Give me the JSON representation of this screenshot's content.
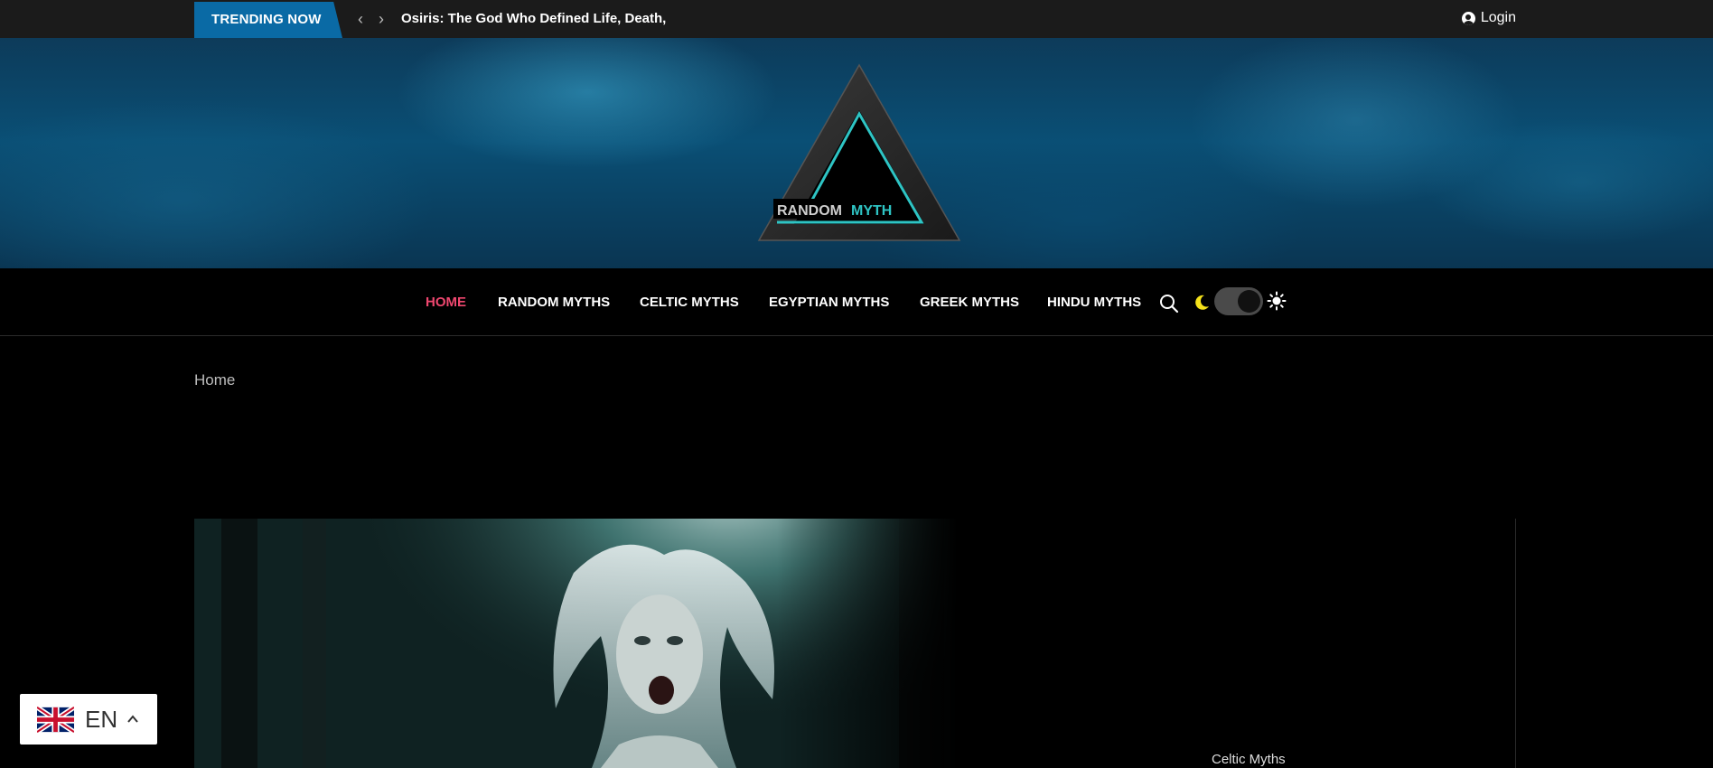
{
  "topbar": {
    "trending_label": "TRENDING NOW",
    "prev_arrow": "‹",
    "next_arrow": "›",
    "headline": "Osiris: The God Who Defined Life, Death,",
    "login_label": "Login"
  },
  "logo": {
    "word1": "RANDOM",
    "word2": "MYTH",
    "accent_color": "#2ec4c4"
  },
  "nav": {
    "items": [
      {
        "label": "HOME",
        "active": true
      },
      {
        "label": "RANDOM MYTHS",
        "active": false
      },
      {
        "label": "CELTIC MYTHS",
        "active": false
      },
      {
        "label": "EGYPTIAN MYTHS",
        "active": false
      },
      {
        "label": "GREEK MYTHS",
        "active": false
      },
      {
        "label": "HINDU MYTHS",
        "active": false
      }
    ],
    "active_color": "#ef476f",
    "icons": [
      "search-icon",
      "moon-icon",
      "theme-toggle",
      "sun-icon"
    ]
  },
  "breadcrumb": {
    "home": "Home"
  },
  "featured": {
    "category": "Celtic Myths"
  },
  "language": {
    "code": "EN",
    "flag": "uk-flag-icon"
  }
}
